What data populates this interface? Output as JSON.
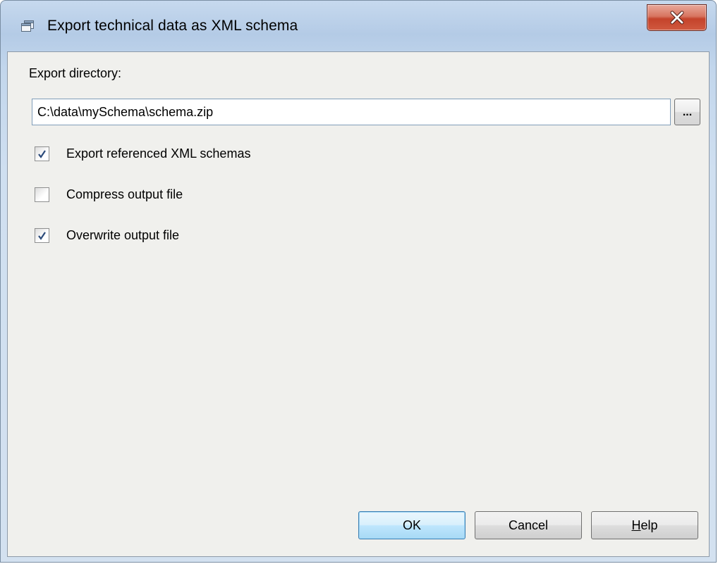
{
  "window": {
    "title": "Export technical data as XML schema",
    "icon": "dialog-window-icon",
    "close_icon": "close-x-icon"
  },
  "form": {
    "directory_label": "Export directory:",
    "directory_value": "C:\\data\\mySchema\\schema.zip",
    "browse_label": "...",
    "options": [
      {
        "label": "Export referenced XML schemas",
        "checked": true
      },
      {
        "label": "Compress output file",
        "checked": false
      },
      {
        "label": "Overwrite output file",
        "checked": true
      }
    ]
  },
  "buttons": {
    "ok_label": "OK",
    "cancel_label": "Cancel",
    "help_label_hotkey": "H",
    "help_label_rest": "elp"
  },
  "colors": {
    "titlebar": "#c6d9ee",
    "client_bg": "#f0f0ed",
    "close_red": "#c4432b",
    "default_button": "#bee6fd"
  }
}
